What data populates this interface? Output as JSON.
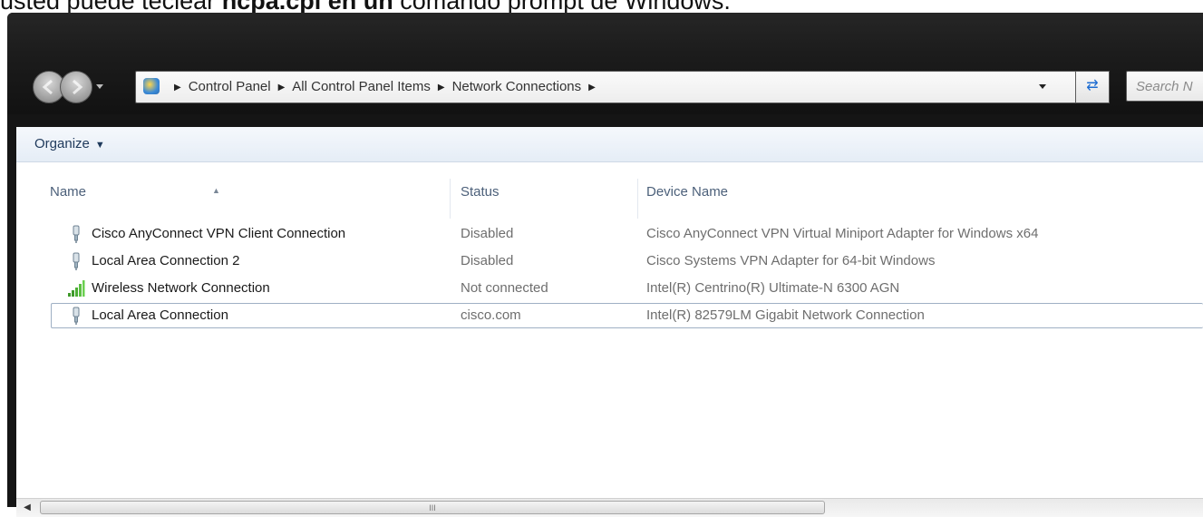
{
  "caption": {
    "prefix": "usted puede teclear ",
    "bold": "ncpa.cpl en un",
    "suffix": " comando prompt de Windows."
  },
  "nav": {
    "back": "back",
    "forward": "forward"
  },
  "address_bar": {
    "crumbs": [
      "Control Panel",
      "All Control Panel Items",
      "Network Connections"
    ]
  },
  "search": {
    "placeholder": "Search N"
  },
  "toolbar": {
    "organize_label": "Organize"
  },
  "columns": {
    "name": "Name",
    "status": "Status",
    "device": "Device Name"
  },
  "rows": [
    {
      "name": "Cisco AnyConnect VPN Client Connection",
      "status": "Disabled",
      "device": "Cisco AnyConnect VPN Virtual Miniport Adapter for Windows x64",
      "icon": "network-adapter-icon"
    },
    {
      "name": "Local Area Connection 2",
      "status": "Disabled",
      "device": "Cisco Systems VPN Adapter for 64-bit Windows",
      "icon": "network-adapter-icon"
    },
    {
      "name": "Wireless Network Connection",
      "status": "Not connected",
      "device": "Intel(R) Centrino(R) Ultimate-N 6300 AGN",
      "icon": "wireless-signal-icon"
    },
    {
      "name": "Local Area Connection",
      "status": "cisco.com",
      "device": "Intel(R) 82579LM Gigabit Network Connection",
      "icon": "network-adapter-icon"
    }
  ],
  "scrollbar": {
    "grip": "III"
  },
  "colors": {
    "accent": "#1e395b",
    "toolbar_bg": "#e5edf6",
    "window_frame": "#151515"
  }
}
